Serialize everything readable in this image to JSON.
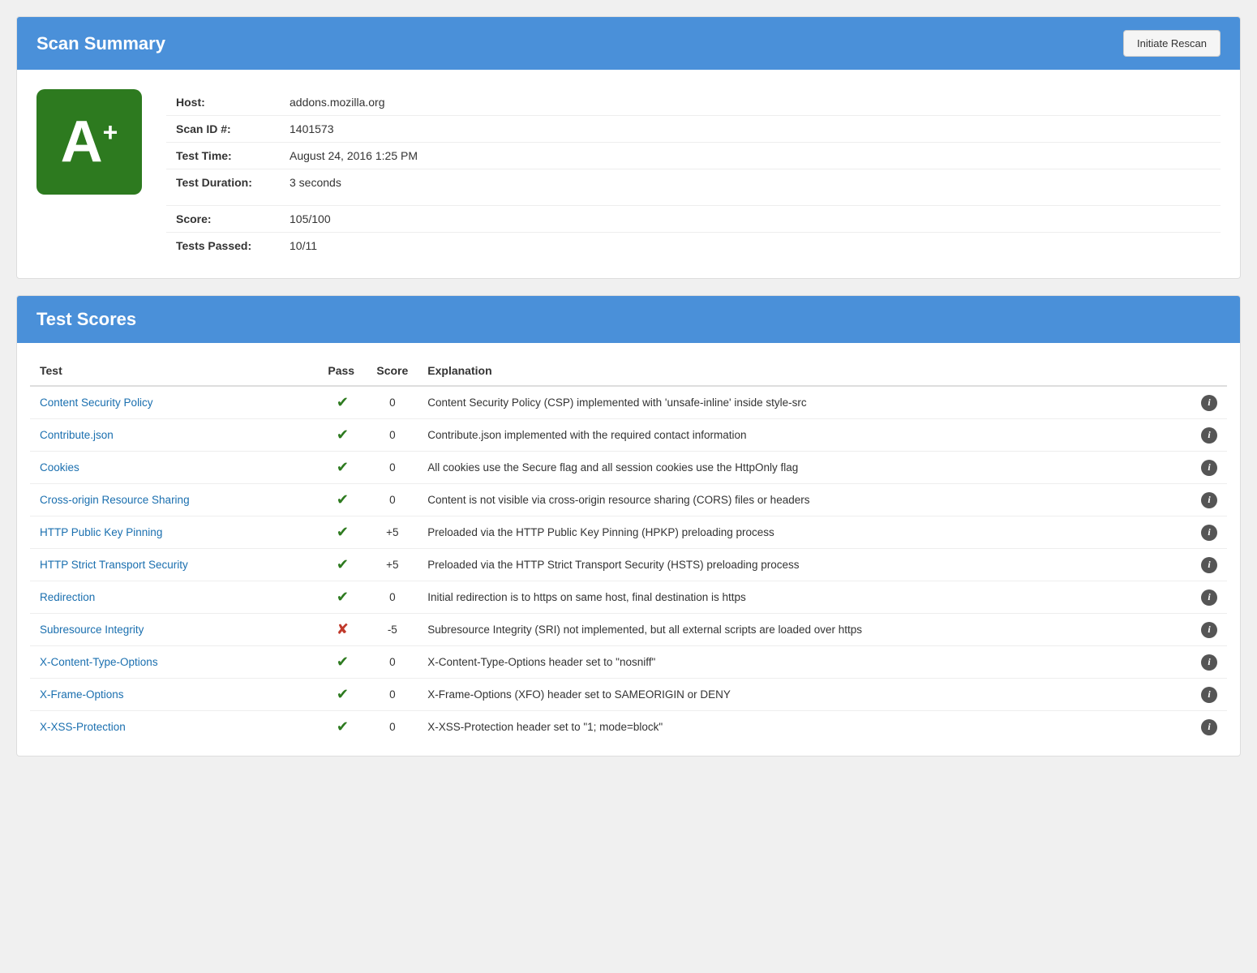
{
  "scanSummary": {
    "title": "Scan Summary",
    "rescanButton": "Initiate Rescan",
    "grade": "A",
    "gradePlus": "+",
    "fields": [
      {
        "label": "Host:",
        "value": "addons.mozilla.org"
      },
      {
        "label": "Scan ID #:",
        "value": "1401573"
      },
      {
        "label": "Test Time:",
        "value": "August 24, 2016 1:25 PM"
      },
      {
        "label": "Test Duration:",
        "value": "3 seconds"
      }
    ],
    "scoreFields": [
      {
        "label": "Score:",
        "value": "105/100"
      },
      {
        "label": "Tests Passed:",
        "value": "10/11"
      }
    ]
  },
  "testScores": {
    "title": "Test Scores",
    "columns": {
      "test": "Test",
      "pass": "Pass",
      "score": "Score",
      "explanation": "Explanation"
    },
    "rows": [
      {
        "name": "Content Security Policy",
        "pass": true,
        "score": "0",
        "explanation": "Content Security Policy (CSP) implemented with 'unsafe-inline' inside style-src"
      },
      {
        "name": "Contribute.json",
        "pass": true,
        "score": "0",
        "explanation": "Contribute.json implemented with the required contact information"
      },
      {
        "name": "Cookies",
        "pass": true,
        "score": "0",
        "explanation": "All cookies use the Secure flag and all session cookies use the HttpOnly flag"
      },
      {
        "name": "Cross-origin Resource Sharing",
        "pass": true,
        "score": "0",
        "explanation": "Content is not visible via cross-origin resource sharing (CORS) files or headers"
      },
      {
        "name": "HTTP Public Key Pinning",
        "pass": true,
        "score": "+5",
        "explanation": "Preloaded via the HTTP Public Key Pinning (HPKP) preloading process"
      },
      {
        "name": "HTTP Strict Transport Security",
        "pass": true,
        "score": "+5",
        "explanation": "Preloaded via the HTTP Strict Transport Security (HSTS) preloading process"
      },
      {
        "name": "Redirection",
        "pass": true,
        "score": "0",
        "explanation": "Initial redirection is to https on same host, final destination is https"
      },
      {
        "name": "Subresource Integrity",
        "pass": false,
        "score": "-5",
        "explanation": "Subresource Integrity (SRI) not implemented, but all external scripts are loaded over https"
      },
      {
        "name": "X-Content-Type-Options",
        "pass": true,
        "score": "0",
        "explanation": "X-Content-Type-Options header set to \"nosniff\""
      },
      {
        "name": "X-Frame-Options",
        "pass": true,
        "score": "0",
        "explanation": "X-Frame-Options (XFO) header set to SAMEORIGIN or DENY"
      },
      {
        "name": "X-XSS-Protection",
        "pass": true,
        "score": "0",
        "explanation": "X-XSS-Protection header set to \"1; mode=block\""
      }
    ]
  }
}
